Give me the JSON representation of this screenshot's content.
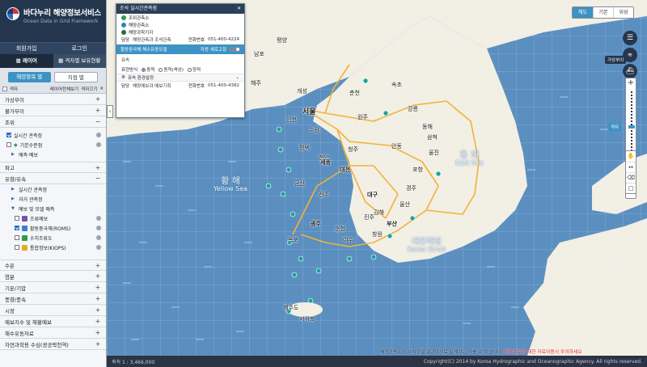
{
  "brand": {
    "title": "바다누리 해양정보서비스",
    "subtitle": "Ocean Data in Grid Framework"
  },
  "auth": {
    "join": "회원가입",
    "login": "로그인"
  },
  "modes": [
    {
      "label": "레이어",
      "active": true
    },
    {
      "label": "격자별 보유현황",
      "active": false
    }
  ],
  "view_buttons": {
    "by_item": "해양항목 별",
    "by_point": "지점 별"
  },
  "subtools": {
    "grid": "격자",
    "layer_full_view": "레이어전체보기",
    "grid_off": "격자끄기"
  },
  "sidebar": {
    "sections": [
      {
        "label": "가상부이",
        "state": "+"
      },
      {
        "label": "물가부이",
        "state": "+"
      },
      {
        "label": "조위",
        "state": "−"
      }
    ],
    "tide_items": [
      {
        "label": "실시간 관측정",
        "checked": true
      },
      {
        "label": "기본수준점",
        "checked": false
      }
    ],
    "tide_forecast": "예측·예보",
    "section_wave": {
      "label": "파고",
      "state": "+"
    },
    "section_current": {
      "label": "유향/유속",
      "state": "−"
    },
    "current_items": [
      "실시간 관측정",
      "과거 관측정",
      "예보 및 모델 예측"
    ],
    "model_items": [
      {
        "label": "조류예보",
        "checked": false
      },
      {
        "label": "황동중국해(ROMS)",
        "checked": true
      },
      {
        "label": "수치조류도",
        "checked": false
      },
      {
        "label": "통합정보(KIOPS)",
        "checked": false
      }
    ],
    "more_sections": [
      "수온",
      "염분",
      "기온/기압",
      "풍향/풍속",
      "시정",
      "예보지수 및 해황예보",
      "해수유동자료",
      "자연과학용 수심(광공략천역)"
    ]
  },
  "info_panel": {
    "title": "조석 실시간관측점",
    "items": [
      "조위관측소",
      "해양관측소",
      "해양과학기지"
    ],
    "contact1": {
      "dept_label": "담당",
      "dept": "해양관측과 조석관측",
      "phone_label": "전화번호",
      "phone": "051-400-4224"
    },
    "model_band": "황동중국해 해수유동모델",
    "auto_refresh": "자동 새로고침",
    "sub_title": "유속",
    "display_label": "표현방식",
    "radio_options": [
      {
        "label": "동적",
        "selected": true
      },
      {
        "label": "동적(색상)",
        "selected": false
      },
      {
        "label": "정적",
        "selected": false
      }
    ],
    "env_settings": "유속 환경설정",
    "contact2": {
      "dept_label": "담당",
      "dept": "해양예보과 예보기획",
      "phone_label": "전화번호",
      "phone": "051-400-4382"
    }
  },
  "map": {
    "cities": [
      "서울",
      "인천",
      "수원",
      "평택",
      "천안",
      "청주",
      "대전",
      "세종",
      "군산",
      "전주",
      "광주",
      "목포",
      "여수",
      "순천",
      "진주",
      "창원",
      "김해",
      "부산",
      "울산",
      "경주",
      "포항",
      "대구",
      "안동",
      "원주",
      "강릉",
      "춘천",
      "속초",
      "동해",
      "삼척",
      "울진",
      "평양",
      "개성",
      "남포",
      "해주",
      "제주도",
      "서귀포"
    ],
    "seas": {
      "east": [
        "동 해",
        "East Sea"
      ],
      "yellow": [
        "황 해",
        "Yellow Sea"
      ],
      "strait": [
        "대한해협",
        "Korea Strait"
      ]
    },
    "basemap_tabs": [
      {
        "label": "해도",
        "active": true
      },
      {
        "label": "기본",
        "active": false
      },
      {
        "label": "위성",
        "active": false
      }
    ],
    "wave_chip": "가상부이",
    "zoom_chip": "격자",
    "notice_gray": "해양관측소의 수치모델 결과이므로 실제와는 다를 수 있습니다.",
    "notice_red": "해상예보에 대한 자료이용시 주의하세요"
  },
  "footer": {
    "scale": "축척 1 : 3,466,000",
    "copyright": "Copyright(C) 2014 by Korea Hydrographic and Oceanographic Agency. All rights reserved."
  },
  "colors": {
    "sidebar_header": "#24364e",
    "accent": "#3d93c4",
    "sea": "#5b8fc0",
    "land": "#f2efe4",
    "alert": "#e22233"
  }
}
